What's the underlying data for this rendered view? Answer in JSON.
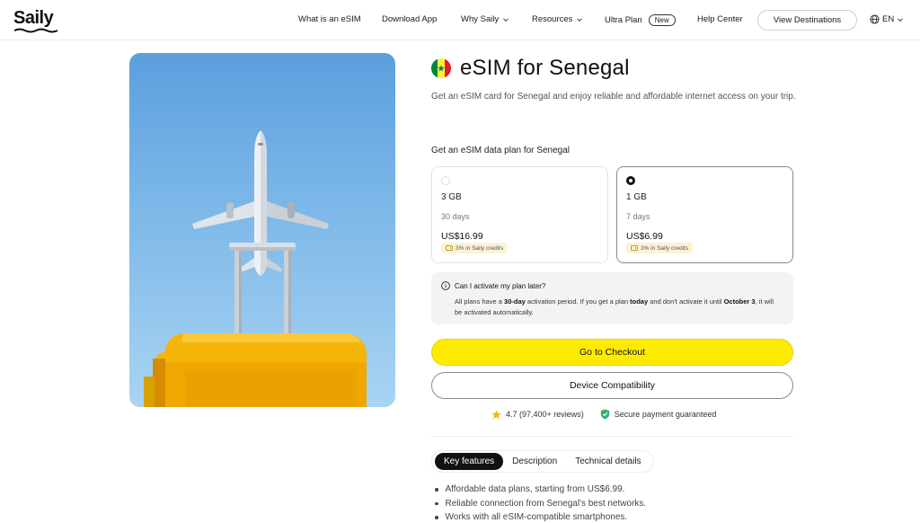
{
  "header": {
    "logo": "Saily",
    "nav": [
      {
        "label": "What is an eSIM"
      },
      {
        "label": "Download App"
      },
      {
        "label": "Why Saily"
      },
      {
        "label": "Resources"
      },
      {
        "label": "Ultra Plan",
        "badge": "New"
      },
      {
        "label": "Help Center"
      }
    ],
    "cta": "View Destinations",
    "language": "EN"
  },
  "product": {
    "title": "eSIM for Senegal",
    "subtitle": "Get an eSIM card for Senegal and enjoy reliable and affordable internet access on your trip.",
    "flag_colors": [
      "#00853f",
      "#fdef42",
      "#e31b23"
    ]
  },
  "plans": {
    "heading": "Get an eSIM data plan for Senegal",
    "items": [
      {
        "size": "3 GB",
        "days": "30 days",
        "price": "US$16.99",
        "credits": "3% in Saily credits",
        "selected": false
      },
      {
        "size": "1 GB",
        "days": "7 days",
        "price": "US$6.99",
        "credits": "3% in Saily credits",
        "selected": true
      }
    ]
  },
  "info": {
    "question": "Can I activate my plan later?",
    "answer_1": "All plans have a ",
    "answer_bold_1": "30-day",
    "answer_2": " activation period. If you get a plan ",
    "answer_bold_2": "today",
    "answer_3": " and don't activate it until ",
    "answer_bold_3": "October 3",
    "answer_4": ", it will be activated automatically."
  },
  "buttons": {
    "checkout": "Go to Checkout",
    "compatibility": "Device Compatibility"
  },
  "trust": {
    "rating": "4.7 (97,400+ reviews)",
    "payment": "Secure payment guaranteed"
  },
  "tabs": [
    {
      "label": "Key features",
      "active": true
    },
    {
      "label": "Description",
      "active": false
    },
    {
      "label": "Technical details",
      "active": false
    }
  ],
  "features": [
    "Affordable data plans, starting from US$6.99.",
    "Reliable connection from Senegal's best networks.",
    "Works with all eSIM-compatible smartphones."
  ],
  "colors": {
    "accent_yellow": "#ffeb00",
    "sky_top": "#5c9fde",
    "suitcase": "#f5b40a"
  }
}
